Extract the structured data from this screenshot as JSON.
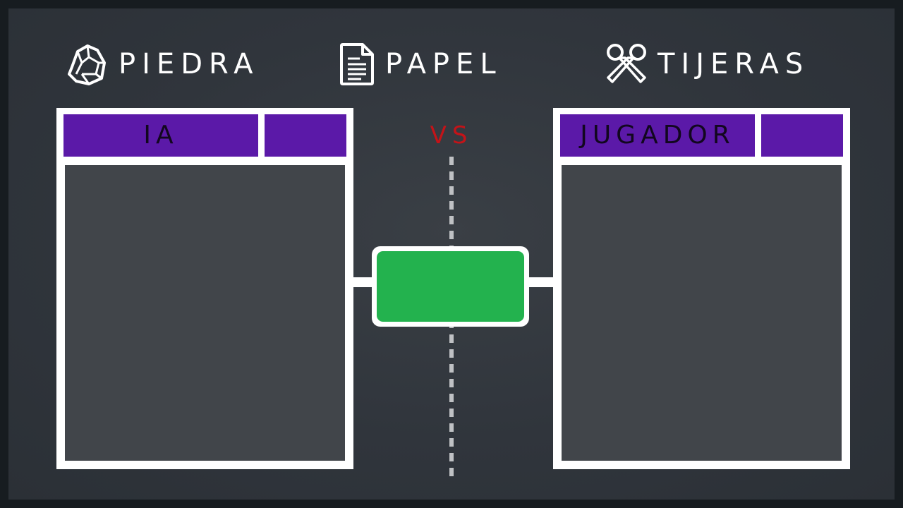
{
  "titles": {
    "rock": {
      "label": "PIEDRA",
      "icon": "rock-icon"
    },
    "paper": {
      "label": "PAPEL",
      "icon": "document-icon"
    },
    "scissors": {
      "label": "TIJERAS",
      "icon": "scissors-icon"
    }
  },
  "vs_label": "VS",
  "panels": {
    "ai": {
      "label": "IA"
    },
    "player": {
      "label": "JUGADOR"
    }
  },
  "colors": {
    "accent_purple": "#5b19a8",
    "vs_red": "#c41318",
    "play_green": "#23b24e",
    "panel_body": "#41454a"
  }
}
